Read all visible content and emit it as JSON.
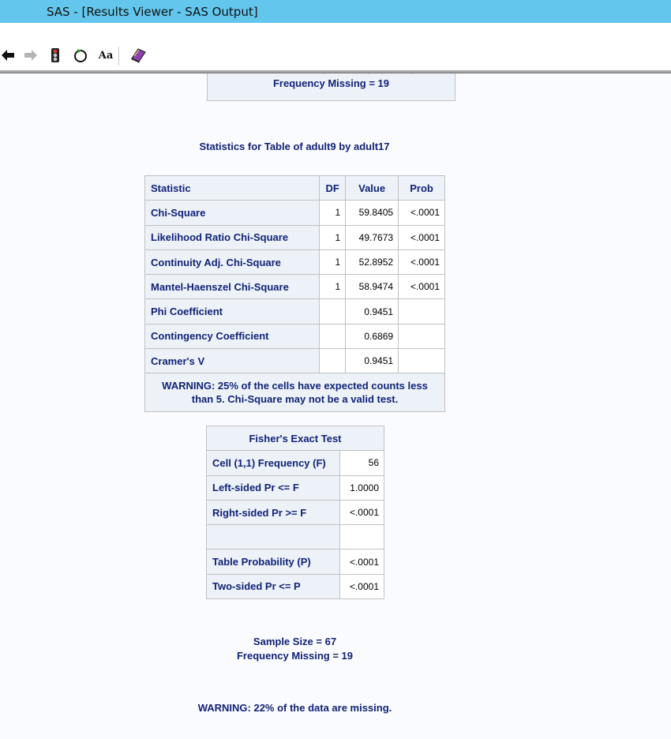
{
  "window": {
    "title": "SAS - [Results Viewer - SAS Output]"
  },
  "toolbar": {
    "buttons": [
      {
        "name": "back-button",
        "icon": "arrow-left-icon"
      },
      {
        "name": "forward-button",
        "icon": "arrow-right-icon"
      },
      {
        "name": "stop-button",
        "icon": "traffic-light-icon"
      },
      {
        "name": "refresh-button",
        "icon": "refresh-icon"
      },
      {
        "name": "font-button",
        "icon": "font-icon",
        "label": "Aa"
      },
      {
        "name": "book-button",
        "icon": "book-icon"
      }
    ]
  },
  "output": {
    "prev_freq_missing": "Frequency Missing = 19",
    "stats_title": "Statistics for Table of adult9 by adult17",
    "stats_table": {
      "headers": [
        "Statistic",
        "DF",
        "Value",
        "Prob"
      ],
      "rows": [
        {
          "statistic": "Chi-Square",
          "df": "1",
          "value": "59.8405",
          "prob": "<.0001"
        },
        {
          "statistic": "Likelihood Ratio Chi-Square",
          "df": "1",
          "value": "49.7673",
          "prob": "<.0001"
        },
        {
          "statistic": "Continuity Adj. Chi-Square",
          "df": "1",
          "value": "52.8952",
          "prob": "<.0001"
        },
        {
          "statistic": "Mantel-Haenszel Chi-Square",
          "df": "1",
          "value": "58.9474",
          "prob": "<.0001"
        },
        {
          "statistic": "Phi Coefficient",
          "df": "",
          "value": "0.9451",
          "prob": ""
        },
        {
          "statistic": "Contingency Coefficient",
          "df": "",
          "value": "0.6869",
          "prob": ""
        },
        {
          "statistic": "Cramer's V",
          "df": "",
          "value": "0.9451",
          "prob": ""
        }
      ],
      "warning_line1": "WARNING: 25% of the cells have expected counts less",
      "warning_line2": "than 5. Chi-Square may not be a valid test."
    },
    "fisher_table": {
      "title": "Fisher's Exact Test",
      "rows": [
        {
          "label": "Cell (1,1) Frequency (F)",
          "value": "56"
        },
        {
          "label": "Left-sided Pr <= F",
          "value": "1.0000"
        },
        {
          "label": "Right-sided Pr >= F",
          "value": "<.0001"
        },
        {
          "label": "",
          "value": ""
        },
        {
          "label": "Table Probability (P)",
          "value": "<.0001"
        },
        {
          "label": "Two-sided Pr <= P",
          "value": "<.0001"
        }
      ]
    },
    "sample_size": "Sample Size = 67",
    "freq_missing": "Frequency Missing = 19",
    "missing_warning": "WARNING: 22% of the data are missing."
  }
}
